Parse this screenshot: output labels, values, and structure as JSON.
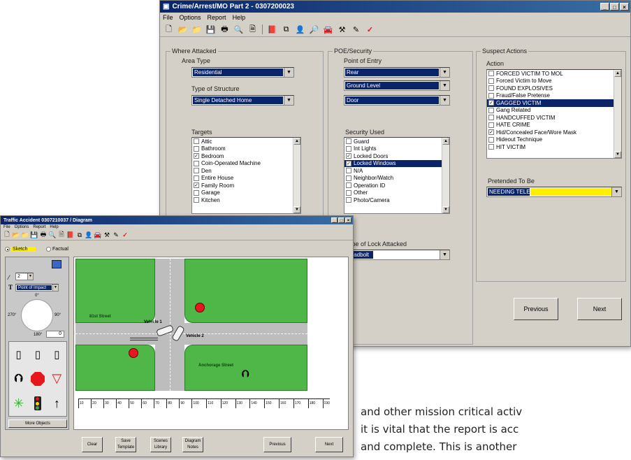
{
  "main_window": {
    "title": "Crime/Arrest/MO Part 2 - 0307200023",
    "menu": [
      "File",
      "Options",
      "Report",
      "Help"
    ],
    "where_attacked": {
      "label": "Where Attacked",
      "area_type_label": "Area Type",
      "area_type_value": "Residential",
      "structure_label": "Type of Structure",
      "structure_value": "Single Detached Home",
      "targets_label": "Targets",
      "targets": [
        {
          "text": "Attic",
          "checked": false
        },
        {
          "text": "Bathroom",
          "checked": false
        },
        {
          "text": "Bedroom",
          "checked": true
        },
        {
          "text": "Coin-Operated Machine",
          "checked": false
        },
        {
          "text": "Den",
          "checked": false
        },
        {
          "text": "Entire House",
          "checked": false
        },
        {
          "text": "Family Room",
          "checked": true
        },
        {
          "text": "Garage",
          "checked": false
        },
        {
          "text": "Kitchen",
          "checked": false
        }
      ]
    },
    "poe_security": {
      "label": "POE/Security",
      "point_of_entry_label": "Point of Entry",
      "entry_values": [
        "Rear",
        "Ground Level",
        "Door"
      ],
      "security_label": "Security Used",
      "security_items": [
        {
          "text": "Guard",
          "checked": false
        },
        {
          "text": "Int Lights",
          "checked": false
        },
        {
          "text": "Locked Doors",
          "checked": true
        },
        {
          "text": "Locked Windows",
          "checked": true,
          "highlight": true
        },
        {
          "text": "N/A",
          "checked": false
        },
        {
          "text": "Neighbor/Watch",
          "checked": false
        },
        {
          "text": "Operation ID",
          "checked": false
        },
        {
          "text": "Other",
          "checked": false
        },
        {
          "text": "Photo/Camera",
          "checked": false
        }
      ],
      "lock_label": "Type of Lock Attacked",
      "lock_value": "Deadbolt"
    },
    "suspect_actions": {
      "label": "Suspect Actions",
      "action_label": "Action",
      "actions": [
        {
          "text": "FORCED VICTIM TO MOL",
          "checked": false
        },
        {
          "text": "Forced Victim to Move",
          "checked": false
        },
        {
          "text": "FOUND EXPLOSIVES",
          "checked": false
        },
        {
          "text": "Fraud/False Pretense",
          "checked": false
        },
        {
          "text": "GAGGED VICTIM",
          "checked": true,
          "highlight": true
        },
        {
          "text": "Gang Related",
          "checked": false
        },
        {
          "text": "HANDCUFFED VICTIM",
          "checked": false
        },
        {
          "text": "HATE CRIME",
          "checked": false
        },
        {
          "text": "Hid/Concealed Face/Wore Mask",
          "checked": true
        },
        {
          "text": "Hideout Technique",
          "checked": false
        },
        {
          "text": "HIT VICTIM",
          "checked": false
        }
      ],
      "pretended_label": "Pretended To Be",
      "pretended_value": "NEEDING TELEPHONE"
    },
    "previous_label": "Previous",
    "next_label": "Next"
  },
  "diagram_window": {
    "title": "Traffic Accident  0307210037 / Diagram",
    "menu": [
      "File",
      "Options",
      "Report",
      "Help"
    ],
    "mode_sketch": "Sketch",
    "mode_factual": "Factual",
    "line_width": "2",
    "text_tool_value": "Point of Impact",
    "compass_top": "0°",
    "compass_left": "270°",
    "compass_right": "90°",
    "compass_bottom": "180°",
    "angle_value": "0",
    "more_objects": "More Objects",
    "street_1": "81st Street",
    "street_2": "Anchorage Street",
    "vehicle_1": "Vehicle 1",
    "vehicle_2": "Vehicle 2",
    "ruler_ticks": [
      "10",
      "20",
      "30",
      "40",
      "50",
      "60",
      "70",
      "80",
      "90",
      "100",
      "110",
      "120",
      "130",
      "140",
      "150",
      "160",
      "170",
      "180",
      "190"
    ],
    "buttons": [
      "Clear",
      "Save Template",
      "Scenes Library",
      "Diagram Notes",
      "Previous",
      "Next"
    ]
  },
  "prose_lines": [
    "and other mission critical activ",
    "it is vital that the report is acc",
    "and complete. This is another"
  ],
  "colors": {
    "title_blue": "#0a246a",
    "highlight_yellow": "#ffef00",
    "grass_green": "#4fb648",
    "marker_red": "#e8161b"
  }
}
